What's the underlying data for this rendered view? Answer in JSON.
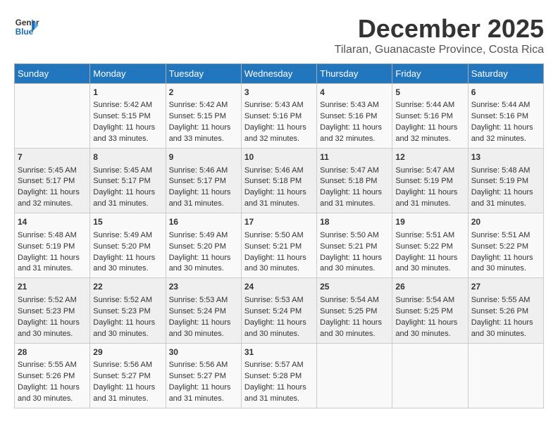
{
  "logo": {
    "line1": "General",
    "line2": "Blue"
  },
  "title": "December 2025",
  "location": "Tilaran, Guanacaste Province, Costa Rica",
  "headers": [
    "Sunday",
    "Monday",
    "Tuesday",
    "Wednesday",
    "Thursday",
    "Friday",
    "Saturday"
  ],
  "weeks": [
    [
      {
        "day": "",
        "info": ""
      },
      {
        "day": "1",
        "info": "Sunrise: 5:42 AM\nSunset: 5:15 PM\nDaylight: 11 hours\nand 33 minutes."
      },
      {
        "day": "2",
        "info": "Sunrise: 5:42 AM\nSunset: 5:15 PM\nDaylight: 11 hours\nand 33 minutes."
      },
      {
        "day": "3",
        "info": "Sunrise: 5:43 AM\nSunset: 5:16 PM\nDaylight: 11 hours\nand 32 minutes."
      },
      {
        "day": "4",
        "info": "Sunrise: 5:43 AM\nSunset: 5:16 PM\nDaylight: 11 hours\nand 32 minutes."
      },
      {
        "day": "5",
        "info": "Sunrise: 5:44 AM\nSunset: 5:16 PM\nDaylight: 11 hours\nand 32 minutes."
      },
      {
        "day": "6",
        "info": "Sunrise: 5:44 AM\nSunset: 5:16 PM\nDaylight: 11 hours\nand 32 minutes."
      }
    ],
    [
      {
        "day": "7",
        "info": "Sunrise: 5:45 AM\nSunset: 5:17 PM\nDaylight: 11 hours\nand 32 minutes."
      },
      {
        "day": "8",
        "info": "Sunrise: 5:45 AM\nSunset: 5:17 PM\nDaylight: 11 hours\nand 31 minutes."
      },
      {
        "day": "9",
        "info": "Sunrise: 5:46 AM\nSunset: 5:17 PM\nDaylight: 11 hours\nand 31 minutes."
      },
      {
        "day": "10",
        "info": "Sunrise: 5:46 AM\nSunset: 5:18 PM\nDaylight: 11 hours\nand 31 minutes."
      },
      {
        "day": "11",
        "info": "Sunrise: 5:47 AM\nSunset: 5:18 PM\nDaylight: 11 hours\nand 31 minutes."
      },
      {
        "day": "12",
        "info": "Sunrise: 5:47 AM\nSunset: 5:19 PM\nDaylight: 11 hours\nand 31 minutes."
      },
      {
        "day": "13",
        "info": "Sunrise: 5:48 AM\nSunset: 5:19 PM\nDaylight: 11 hours\nand 31 minutes."
      }
    ],
    [
      {
        "day": "14",
        "info": "Sunrise: 5:48 AM\nSunset: 5:19 PM\nDaylight: 11 hours\nand 31 minutes."
      },
      {
        "day": "15",
        "info": "Sunrise: 5:49 AM\nSunset: 5:20 PM\nDaylight: 11 hours\nand 30 minutes."
      },
      {
        "day": "16",
        "info": "Sunrise: 5:49 AM\nSunset: 5:20 PM\nDaylight: 11 hours\nand 30 minutes."
      },
      {
        "day": "17",
        "info": "Sunrise: 5:50 AM\nSunset: 5:21 PM\nDaylight: 11 hours\nand 30 minutes."
      },
      {
        "day": "18",
        "info": "Sunrise: 5:50 AM\nSunset: 5:21 PM\nDaylight: 11 hours\nand 30 minutes."
      },
      {
        "day": "19",
        "info": "Sunrise: 5:51 AM\nSunset: 5:22 PM\nDaylight: 11 hours\nand 30 minutes."
      },
      {
        "day": "20",
        "info": "Sunrise: 5:51 AM\nSunset: 5:22 PM\nDaylight: 11 hours\nand 30 minutes."
      }
    ],
    [
      {
        "day": "21",
        "info": "Sunrise: 5:52 AM\nSunset: 5:23 PM\nDaylight: 11 hours\nand 30 minutes."
      },
      {
        "day": "22",
        "info": "Sunrise: 5:52 AM\nSunset: 5:23 PM\nDaylight: 11 hours\nand 30 minutes."
      },
      {
        "day": "23",
        "info": "Sunrise: 5:53 AM\nSunset: 5:24 PM\nDaylight: 11 hours\nand 30 minutes."
      },
      {
        "day": "24",
        "info": "Sunrise: 5:53 AM\nSunset: 5:24 PM\nDaylight: 11 hours\nand 30 minutes."
      },
      {
        "day": "25",
        "info": "Sunrise: 5:54 AM\nSunset: 5:25 PM\nDaylight: 11 hours\nand 30 minutes."
      },
      {
        "day": "26",
        "info": "Sunrise: 5:54 AM\nSunset: 5:25 PM\nDaylight: 11 hours\nand 30 minutes."
      },
      {
        "day": "27",
        "info": "Sunrise: 5:55 AM\nSunset: 5:26 PM\nDaylight: 11 hours\nand 30 minutes."
      }
    ],
    [
      {
        "day": "28",
        "info": "Sunrise: 5:55 AM\nSunset: 5:26 PM\nDaylight: 11 hours\nand 30 minutes."
      },
      {
        "day": "29",
        "info": "Sunrise: 5:56 AM\nSunset: 5:27 PM\nDaylight: 11 hours\nand 31 minutes."
      },
      {
        "day": "30",
        "info": "Sunrise: 5:56 AM\nSunset: 5:27 PM\nDaylight: 11 hours\nand 31 minutes."
      },
      {
        "day": "31",
        "info": "Sunrise: 5:57 AM\nSunset: 5:28 PM\nDaylight: 11 hours\nand 31 minutes."
      },
      {
        "day": "",
        "info": ""
      },
      {
        "day": "",
        "info": ""
      },
      {
        "day": "",
        "info": ""
      }
    ]
  ]
}
